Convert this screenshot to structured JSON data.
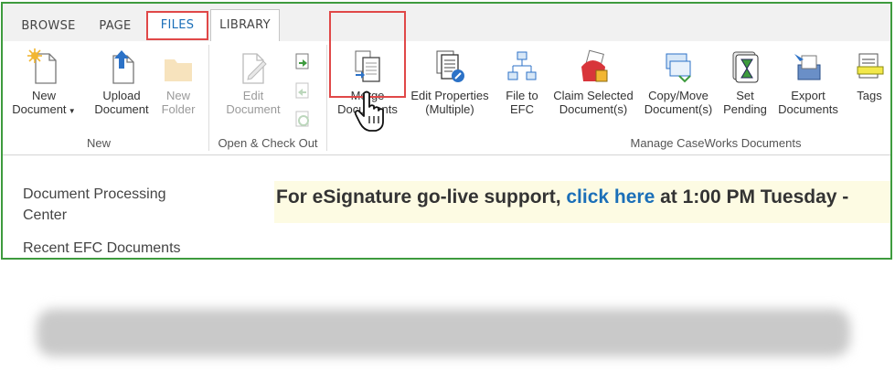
{
  "tabs": {
    "browse": "BROWSE",
    "page": "PAGE",
    "files": "FILES",
    "library": "LIBRARY"
  },
  "ribbon": {
    "new_group": {
      "new_document": [
        "New",
        "Document"
      ],
      "upload_document": [
        "Upload",
        "Document"
      ],
      "new_folder": [
        "New",
        "Folder"
      ],
      "label": "New"
    },
    "checkout_group": {
      "edit_document": [
        "Edit",
        "Document"
      ],
      "label": "Open & Check Out"
    },
    "caseworks_group": {
      "merge_documents": [
        "Merge",
        "Documents"
      ],
      "edit_properties": [
        "Edit Properties",
        "(Multiple)"
      ],
      "file_to_efc": [
        "File to",
        "EFC"
      ],
      "claim_selected": [
        "Claim Selected",
        "Document(s)"
      ],
      "copy_move": [
        "Copy/Move",
        "Document(s)"
      ],
      "set_pending": [
        "Set",
        "Pending"
      ],
      "export_documents": [
        "Export",
        "Documents"
      ],
      "tags": [
        "Tags",
        ""
      ],
      "label": "Manage CaseWorks Documents"
    }
  },
  "nav": {
    "item1_line1": "Document Processing",
    "item1_line2": "Center",
    "item2": "Recent EFC Documents"
  },
  "banner": {
    "prefix": "For eSignature go-live support, ",
    "link": "click here",
    "suffix": " at 1:00 PM Tuesday -"
  },
  "colors": {
    "frame_border": "#3e9b3e",
    "highlight_box": "#e04848",
    "link": "#1b6fb8",
    "banner_bg": "#fdfbe3"
  }
}
